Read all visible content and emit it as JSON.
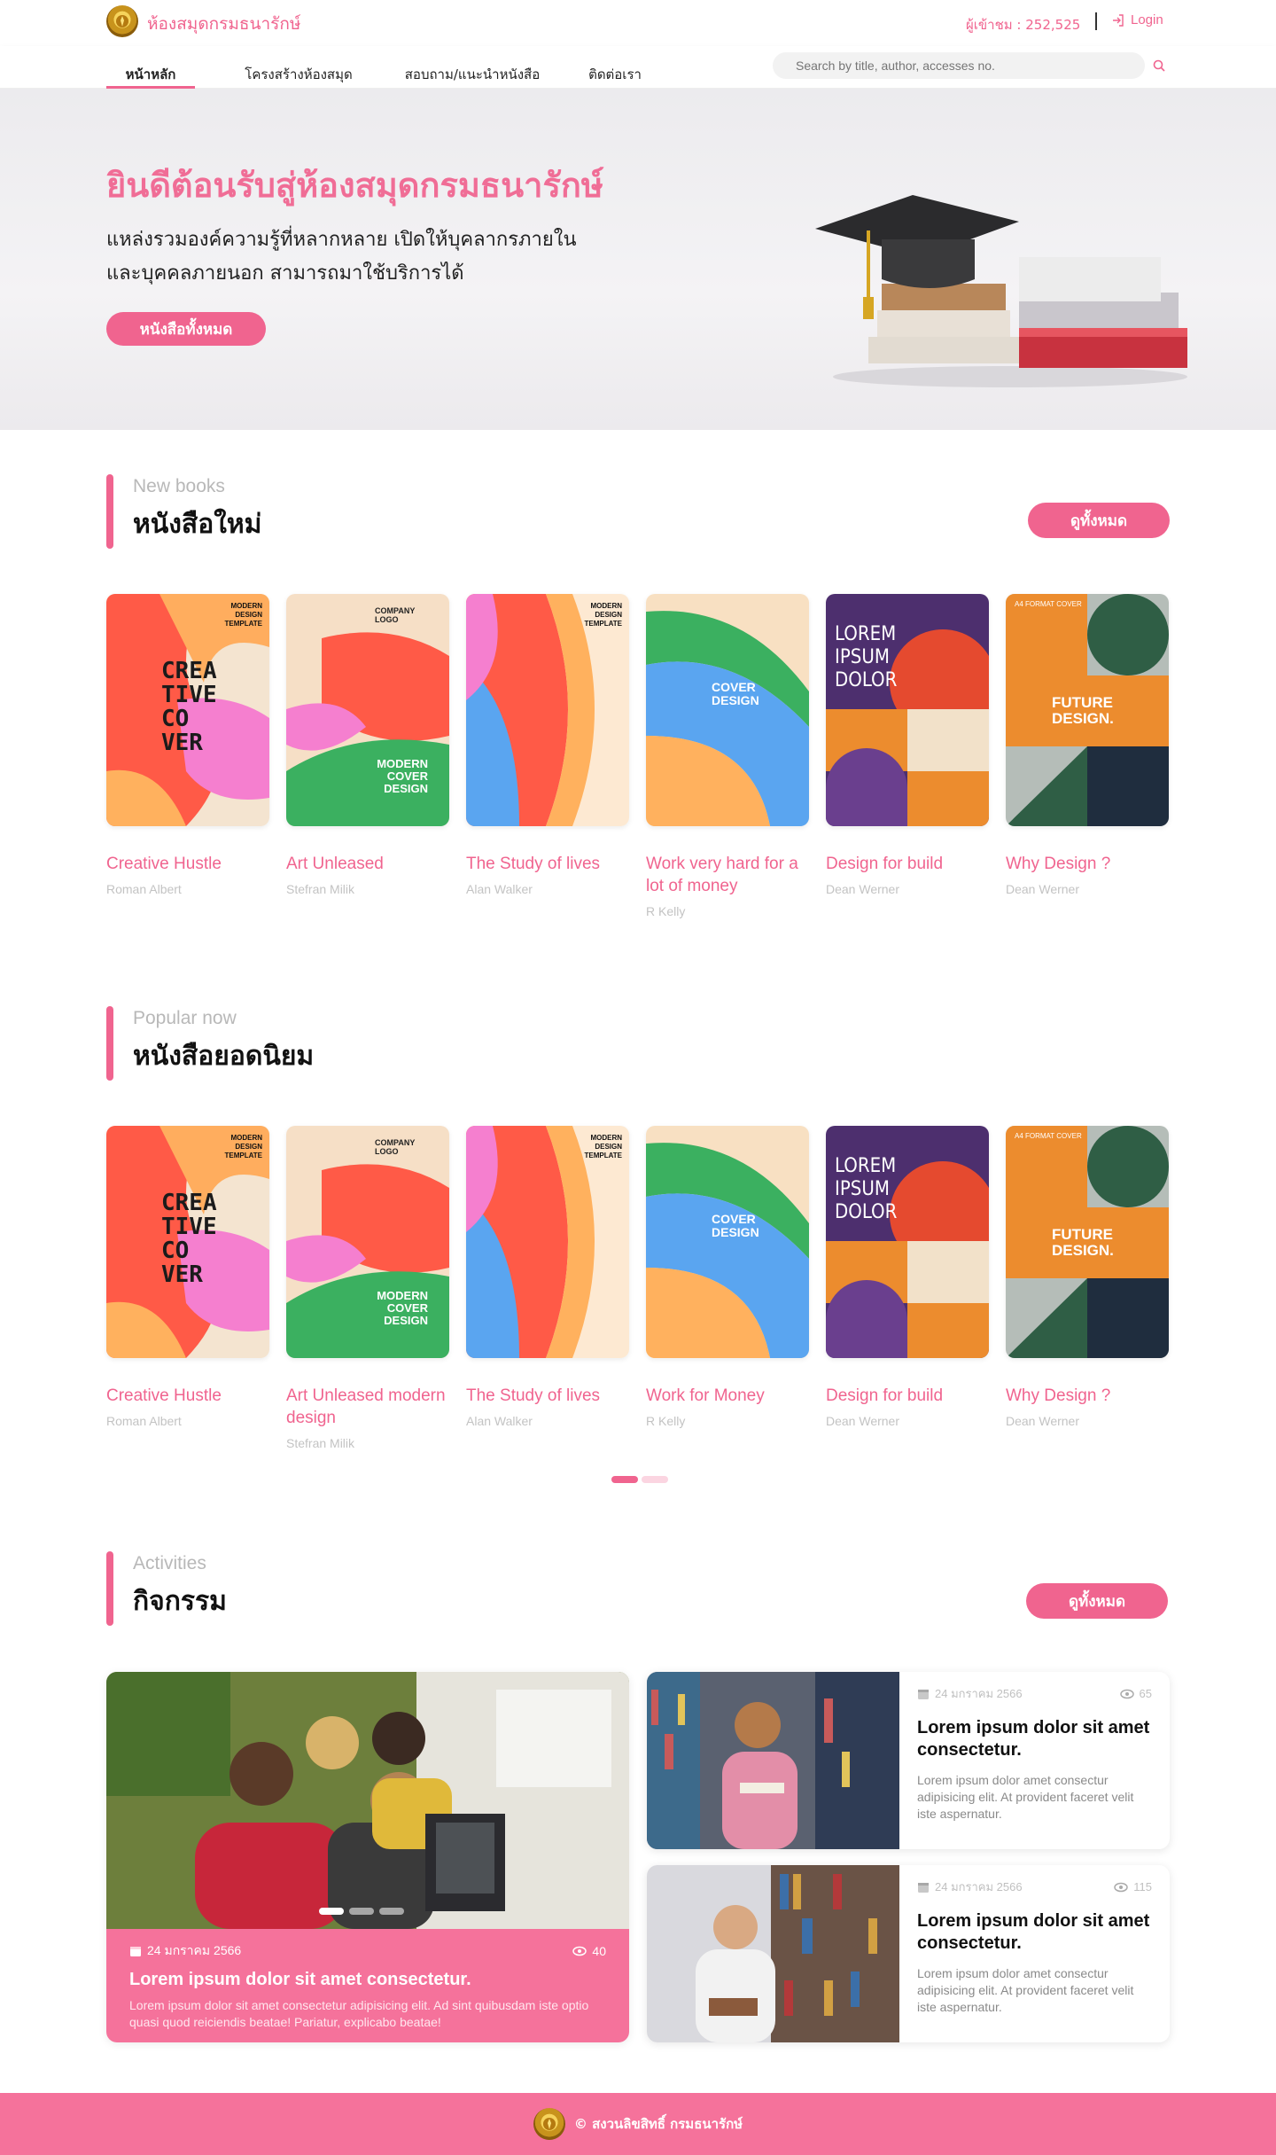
{
  "header": {
    "site_name": "ห้องสมุดกรมธนารักษ์",
    "visitors": "ผู้เข้าชม : 252,525",
    "login_label": "Login"
  },
  "nav": {
    "items": [
      {
        "label": "หน้าหลัก"
      },
      {
        "label": "โครงสร้างห้องสมุด"
      },
      {
        "label": "สอบถาม/แนะนำหนังสือ"
      },
      {
        "label": "ติดต่อเรา"
      }
    ],
    "search_placeholder": "Search by title, author, accesses no."
  },
  "hero": {
    "title": "ยินดีต้อนรับสู่ห้องสมุดกรมธนารักษ์",
    "desc_line1": "แหล่งรวมองค์ความรู้ที่หลากหลาย เปิดให้บุคลากรภายใน",
    "desc_line2": "และบุคคลภายนอก สามารถมาใช้บริการได้",
    "button": "หนังสือทั้งหมด"
  },
  "new_books": {
    "label_en": "New books",
    "label_th": "หนังสือใหม่",
    "see_all": "ดูทั้งหมด",
    "books": [
      {
        "title": "Creative Hustle",
        "author": "Roman Albert"
      },
      {
        "title": "Art Unleased",
        "author": "Stefran Milik"
      },
      {
        "title": "The Study of lives",
        "author": "Alan Walker"
      },
      {
        "title": "Work very hard for a lot of money",
        "author": "R Kelly"
      },
      {
        "title": "Design for build",
        "author": "Dean Werner"
      },
      {
        "title": "Why Design ?",
        "author": "Dean Werner"
      }
    ]
  },
  "popular": {
    "label_en": "Popular now",
    "label_th": "หนังสือยอดนิยม",
    "books": [
      {
        "title": "Creative Hustle",
        "author": "Roman Albert"
      },
      {
        "title": "Art Unleased modern design",
        "author": "Stefran Milik"
      },
      {
        "title": "The Study of lives",
        "author": "Alan Walker"
      },
      {
        "title": "Work for Money",
        "author": "R Kelly"
      },
      {
        "title": "Design for build",
        "author": "Dean Werner"
      },
      {
        "title": "Why Design ?",
        "author": "Dean Werner"
      }
    ]
  },
  "covers": {
    "c1_text1": "MODERN",
    "c1_text2": "DESIGN",
    "c1_text3": "TEMPLATE",
    "c1_big1": "CREA",
    "c1_big2": "TIVE",
    "c1_big3": "CO",
    "c1_big4": "VER",
    "c2_logo1": "COMPANY",
    "c2_logo2": "LOGO",
    "c2_big1": "MODERN",
    "c2_big2": "COVER",
    "c2_big3": "DESIGN",
    "c4_big1": "COVER",
    "c4_big2": "DESIGN",
    "c5_big1": "LOREM",
    "c5_big2": "IPSUM",
    "c5_big3": "DOLOR",
    "c6_small": "A4 FORMAT COVER",
    "c6_big1": "FUTURE",
    "c6_big2": "DESIGN."
  },
  "activities": {
    "label_en": "Activities",
    "label_th": "กิจกรรม",
    "see_all": "ดูทั้งหมด",
    "main": {
      "date": "24 มกราคม 2566",
      "views": "40",
      "title": "Lorem ipsum dolor sit amet consectetur.",
      "text": "Lorem ipsum dolor sit amet consectetur adipisicing elit. Ad sint quibusdam iste optio quasi quod reiciendis beatae! Pariatur, explicabo beatae!"
    },
    "cards": [
      {
        "date": "24 มกราคม 2566",
        "views": "65",
        "title": "Lorem ipsum dolor sit amet consectetur.",
        "text": "Lorem ipsum dolor amet consectur adipisicing elit. At provident faceret velit iste aspernatur."
      },
      {
        "date": "24 มกราคม 2566",
        "views": "115",
        "title": "Lorem ipsum dolor sit amet consectetur.",
        "text": "Lorem ipsum dolor amet consectur adipisicing elit. At provident faceret velit iste aspernatur."
      }
    ]
  },
  "footer": {
    "text": "© สงวนลิขสิทธิ์ กรมธนารักษ์"
  },
  "colors": {
    "accent": "#f0648f",
    "footer": "#f5729b"
  }
}
